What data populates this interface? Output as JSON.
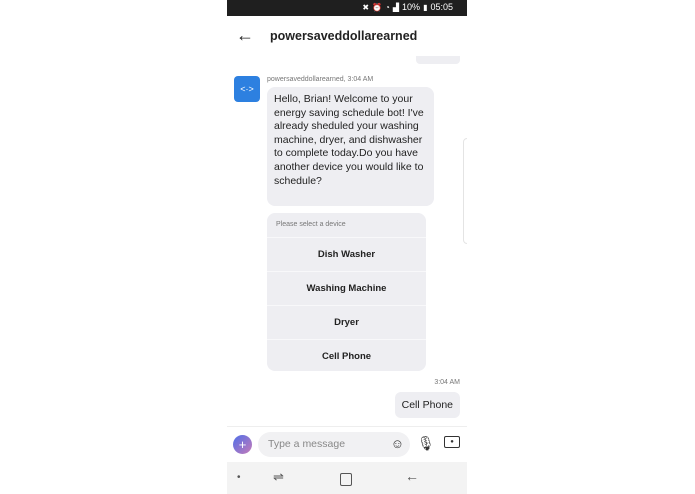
{
  "status": {
    "battery": "10%",
    "time": "05:05",
    "icons": [
      "mute-icon",
      "alarm-icon",
      "wifi-icon",
      "signal-icon",
      "battery-icon"
    ]
  },
  "header": {
    "back_icon": "arrow-left-icon",
    "title": "powersaveddollarearned"
  },
  "chat": {
    "previous_reset_label": "Reset",
    "bot_avatar_icon": "code-brackets-icon",
    "bot_sender": "powersaveddollarearned, 3:04 AM",
    "bot_message": "Hello, Brian! Welcome to your energy saving schedule bot! I've already sheduled your washing machine, dryer, and dishwasher to complete today.Do you have another device you would like to schedule?",
    "card": {
      "prompt": "Please select a device",
      "options": [
        "Dish Washer",
        "Washing Machine",
        "Dryer",
        "Cell Phone"
      ]
    },
    "user_time": "3:04 AM",
    "user_message": "Cell Phone"
  },
  "composer": {
    "placeholder": "Type a message",
    "plus_icon": "plus-icon",
    "emoji_icon": "emoji-icon",
    "mic_icon": "mic-icon",
    "camera_icon": "camera-icon"
  },
  "navbar": {
    "icons": [
      "dot-icon",
      "recent-apps-icon",
      "home-icon",
      "back-icon"
    ]
  }
}
